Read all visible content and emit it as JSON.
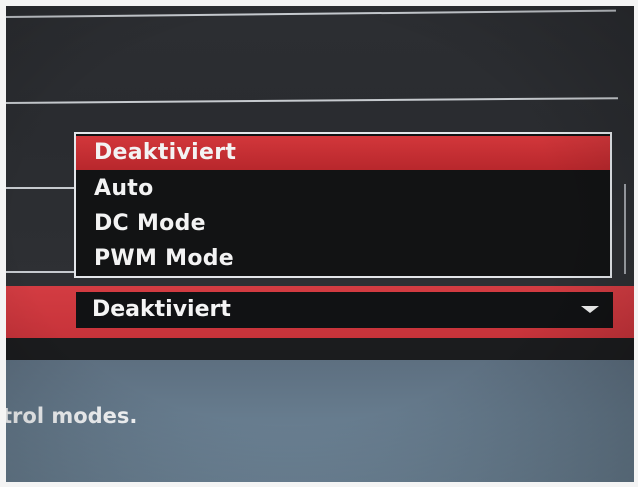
{
  "dropdown": {
    "options": [
      {
        "label": "Deaktiviert",
        "selected": true
      },
      {
        "label": "Auto",
        "selected": false
      },
      {
        "label": "DC Mode",
        "selected": false
      },
      {
        "label": "PWM Mode",
        "selected": false
      }
    ],
    "current_value": "Deaktiviert",
    "arrow_icon": "triangle-down"
  },
  "help": {
    "text": "trol modes."
  },
  "colors": {
    "accent": "#d33c42",
    "menu_bg": "#121314",
    "help_panel": "#667b8d"
  }
}
